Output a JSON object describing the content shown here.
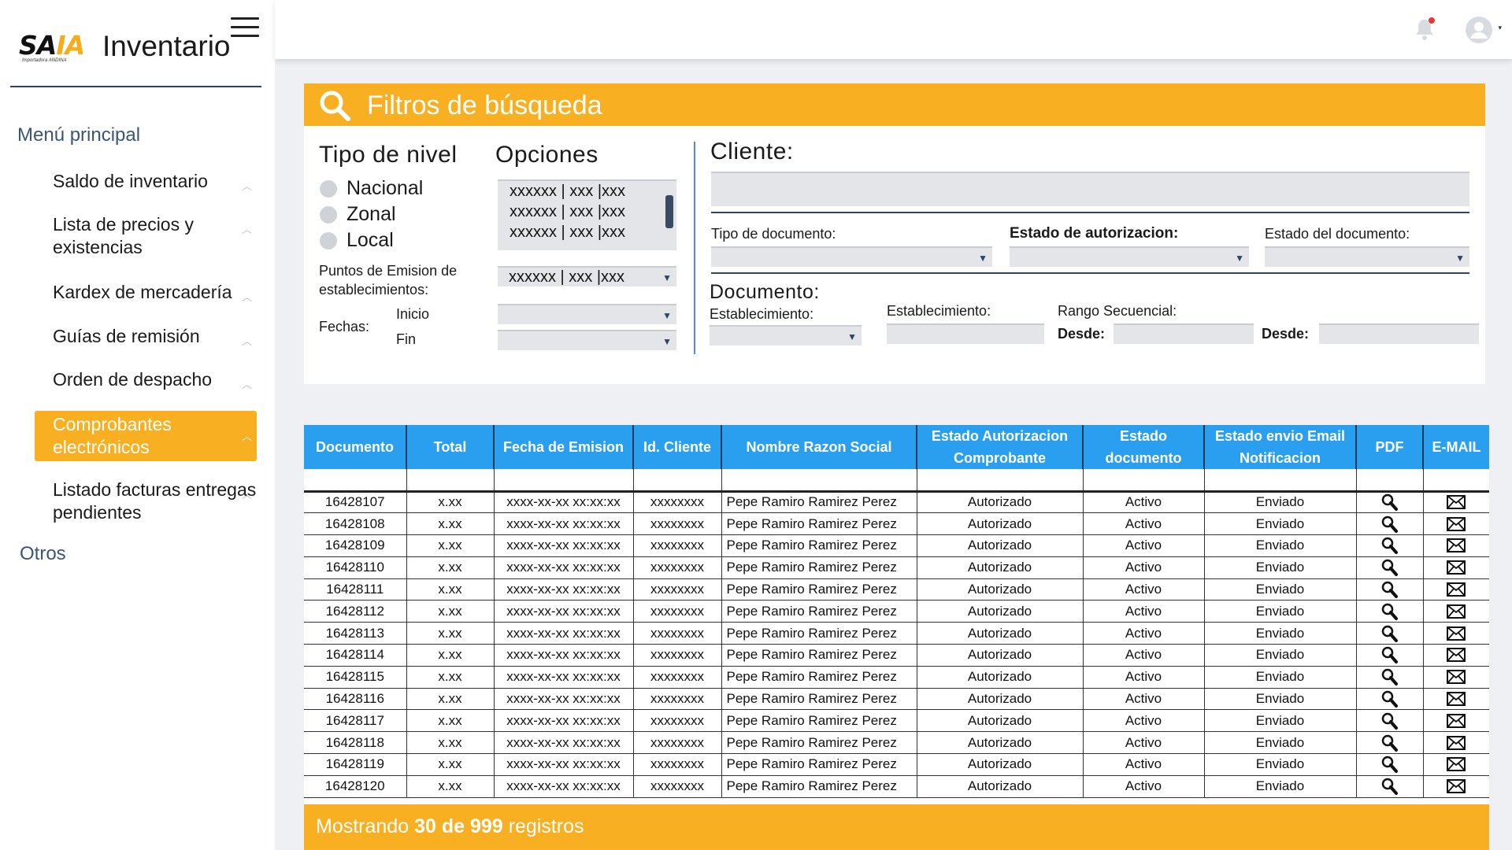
{
  "brand": {
    "logo_main": "SA",
    "logo_accent": "IA",
    "logo_tagline": "Importadora ANDINA",
    "app_title": "Inventario"
  },
  "sidebar": {
    "heading": "Menú principal",
    "items": [
      {
        "label": "Saldo de inventario"
      },
      {
        "label": "Lista de precios y existencias"
      },
      {
        "label": "Kardex de mercadería"
      },
      {
        "label": "Guías de remisión"
      },
      {
        "label": "Orden de despacho"
      },
      {
        "label": "Comprobantes electrónicos",
        "active": true
      },
      {
        "label": "Listado facturas entregas pendientes"
      }
    ],
    "other": "Otros"
  },
  "colors": {
    "accent": "#f8b022",
    "table_header": "#2a9ff0",
    "navy": "#2e4462"
  },
  "filters": {
    "title": "Filtros de búsqueda",
    "tipo_nivel": {
      "label": "Tipo de nivel",
      "options": [
        "Nacional",
        "Zonal",
        "Local"
      ]
    },
    "opciones": {
      "label": "Opciones",
      "items": [
        "xxxxxx | xxx |xxx",
        "xxxxxx | xxx |xxx",
        "xxxxxx | xxx |xxx"
      ]
    },
    "puntos_emision": {
      "label": "Puntos de Emision de establecimientos:",
      "value": "xxxxxx | xxx |xxx"
    },
    "fechas": {
      "label": "Fechas:",
      "inicio": "Inicio",
      "fin": "Fin"
    },
    "cliente": {
      "label": "Cliente:",
      "value": ""
    },
    "tipo_documento": {
      "label": "Tipo de documento:"
    },
    "estado_autorizacion": {
      "label": "Estado de autorizacion:"
    },
    "estado_documento": {
      "label": "Estado del documento:"
    },
    "documento": {
      "label": "Documento:",
      "establecimiento_select": "Establecimiento:",
      "establecimiento_input": "Establecimiento:",
      "rango": "Rango Secuencial:",
      "desde1": "Desde:",
      "desde2": "Desde:"
    }
  },
  "table": {
    "headers": [
      "Documento",
      "Total",
      "Fecha de Emision",
      "Id. Cliente",
      "Nombre Razon Social",
      "Estado Autorizacion Comprobante",
      "Estado documento",
      "Estado envio Email Notificacion",
      "PDF",
      "E-MAIL"
    ],
    "rows": [
      [
        "16428107",
        "x.xx",
        "xxxx-xx-xx xx:xx:xx",
        "xxxxxxxx",
        "Pepe Ramiro Ramirez Perez",
        "Autorizado",
        "Activo",
        "Enviado"
      ],
      [
        "16428108",
        "x.xx",
        "xxxx-xx-xx xx:xx:xx",
        "xxxxxxxx",
        "Pepe Ramiro Ramirez Perez",
        "Autorizado",
        "Activo",
        "Enviado"
      ],
      [
        "16428109",
        "x.xx",
        "xxxx-xx-xx xx:xx:xx",
        "xxxxxxxx",
        "Pepe Ramiro Ramirez Perez",
        "Autorizado",
        "Activo",
        "Enviado"
      ],
      [
        "16428110",
        "x.xx",
        "xxxx-xx-xx xx:xx:xx",
        "xxxxxxxx",
        "Pepe Ramiro Ramirez Perez",
        "Autorizado",
        "Activo",
        "Enviado"
      ],
      [
        "16428111",
        "x.xx",
        "xxxx-xx-xx xx:xx:xx",
        "xxxxxxxx",
        "Pepe Ramiro Ramirez Perez",
        "Autorizado",
        "Activo",
        "Enviado"
      ],
      [
        "16428112",
        "x.xx",
        "xxxx-xx-xx xx:xx:xx",
        "xxxxxxxx",
        "Pepe Ramiro Ramirez Perez",
        "Autorizado",
        "Activo",
        "Enviado"
      ],
      [
        "16428113",
        "x.xx",
        "xxxx-xx-xx xx:xx:xx",
        "xxxxxxxx",
        "Pepe Ramiro Ramirez Perez",
        "Autorizado",
        "Activo",
        "Enviado"
      ],
      [
        "16428114",
        "x.xx",
        "xxxx-xx-xx xx:xx:xx",
        "xxxxxxxx",
        "Pepe Ramiro Ramirez Perez",
        "Autorizado",
        "Activo",
        "Enviado"
      ],
      [
        "16428115",
        "x.xx",
        "xxxx-xx-xx xx:xx:xx",
        "xxxxxxxx",
        "Pepe Ramiro Ramirez Perez",
        "Autorizado",
        "Activo",
        "Enviado"
      ],
      [
        "16428116",
        "x.xx",
        "xxxx-xx-xx xx:xx:xx",
        "xxxxxxxx",
        "Pepe Ramiro Ramirez Perez",
        "Autorizado",
        "Activo",
        "Enviado"
      ],
      [
        "16428117",
        "x.xx",
        "xxxx-xx-xx xx:xx:xx",
        "xxxxxxxx",
        "Pepe Ramiro Ramirez Perez",
        "Autorizado",
        "Activo",
        "Enviado"
      ],
      [
        "16428118",
        "x.xx",
        "xxxx-xx-xx xx:xx:xx",
        "xxxxxxxx",
        "Pepe Ramiro Ramirez Perez",
        "Autorizado",
        "Activo",
        "Enviado"
      ],
      [
        "16428119",
        "x.xx",
        "xxxx-xx-xx xx:xx:xx",
        "xxxxxxxx",
        "Pepe Ramiro Ramirez Perez",
        "Autorizado",
        "Activo",
        "Enviado"
      ],
      [
        "16428120",
        "x.xx",
        "xxxx-xx-xx xx:xx:xx",
        "xxxxxxxx",
        "Pepe Ramiro Ramirez Perez",
        "Autorizado",
        "Activo",
        "Enviado"
      ]
    ]
  },
  "footer": {
    "prefix": "Mostrando",
    "count": "30 de 999",
    "suffix": "registros"
  }
}
